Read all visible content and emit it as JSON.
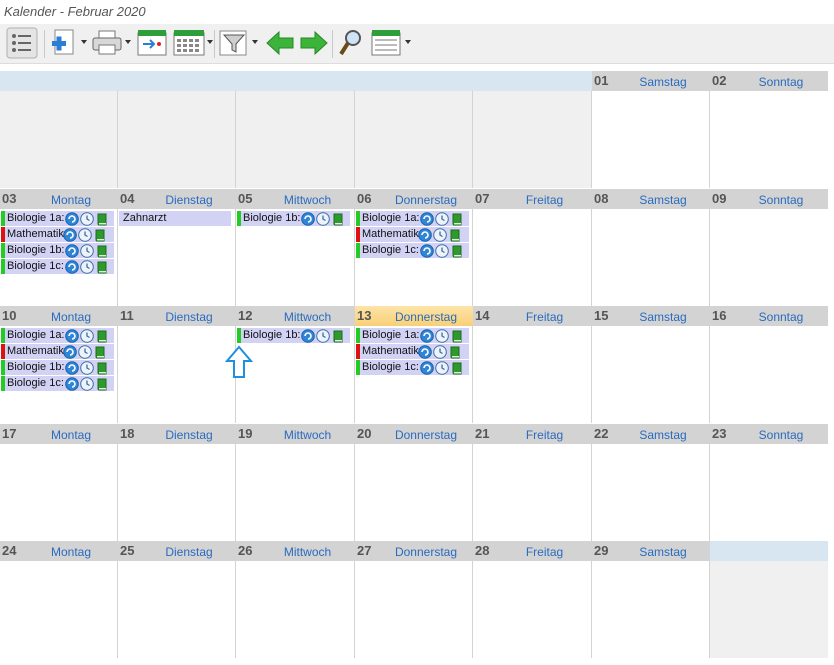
{
  "window": {
    "title": "Kalender - Februar 2020"
  },
  "toolbar": {
    "icons": [
      "list-icon",
      "add-document-icon",
      "print-icon",
      "goto-date-icon",
      "calendar-grid-icon",
      "filter-icon",
      "back-arrow-icon",
      "forward-arrow-icon",
      "search-icon",
      "calendar-view-icon"
    ]
  },
  "colors": {
    "header_gray": "#d3d3d3",
    "header_blue": "#d8e6f2",
    "today": "#f8cf77",
    "event_bg": "#d2d2f5",
    "green": "#22cc22",
    "red": "#dd1111",
    "dayname": "#2a6bbf"
  },
  "weeks": [
    {
      "days": [
        {
          "num": "",
          "name": ""
        },
        {
          "num": "",
          "name": ""
        },
        {
          "num": "",
          "name": ""
        },
        {
          "num": "",
          "name": ""
        },
        {
          "num": "",
          "name": ""
        },
        {
          "num": "01",
          "name": "Samstag"
        },
        {
          "num": "02",
          "name": "Sonntag"
        }
      ]
    },
    {
      "days": [
        {
          "num": "03",
          "name": "Montag"
        },
        {
          "num": "04",
          "name": "Dienstag"
        },
        {
          "num": "05",
          "name": "Mittwoch"
        },
        {
          "num": "06",
          "name": "Donnerstag"
        },
        {
          "num": "07",
          "name": "Freitag"
        },
        {
          "num": "08",
          "name": "Samstag"
        },
        {
          "num": "09",
          "name": "Sonntag"
        }
      ]
    },
    {
      "days": [
        {
          "num": "10",
          "name": "Montag"
        },
        {
          "num": "11",
          "name": "Dienstag"
        },
        {
          "num": "12",
          "name": "Mittwoch"
        },
        {
          "num": "13",
          "name": "Donnerstag",
          "today": true
        },
        {
          "num": "14",
          "name": "Freitag"
        },
        {
          "num": "15",
          "name": "Samstag"
        },
        {
          "num": "16",
          "name": "Sonntag"
        }
      ]
    },
    {
      "days": [
        {
          "num": "17",
          "name": "Montag"
        },
        {
          "num": "18",
          "name": "Dienstag"
        },
        {
          "num": "19",
          "name": "Mittwoch"
        },
        {
          "num": "20",
          "name": "Donnerstag"
        },
        {
          "num": "21",
          "name": "Freitag"
        },
        {
          "num": "22",
          "name": "Samstag"
        },
        {
          "num": "23",
          "name": "Sonntag"
        }
      ]
    },
    {
      "days": [
        {
          "num": "24",
          "name": "Montag"
        },
        {
          "num": "25",
          "name": "Dienstag"
        },
        {
          "num": "26",
          "name": "Mittwoch"
        },
        {
          "num": "27",
          "name": "Donnerstag"
        },
        {
          "num": "28",
          "name": "Freitag"
        },
        {
          "num": "29",
          "name": "Samstag"
        },
        {
          "num": "",
          "name": ""
        }
      ]
    }
  ],
  "events": [
    {
      "week": 1,
      "day": 0,
      "label": "Biologie 1a:",
      "bar": "green",
      "icons": true
    },
    {
      "week": 1,
      "day": 0,
      "label": "Mathematik",
      "bar": "red",
      "icons": true
    },
    {
      "week": 1,
      "day": 0,
      "label": "Biologie 1b:",
      "bar": "green",
      "icons": true
    },
    {
      "week": 1,
      "day": 0,
      "label": "Biologie 1c:",
      "bar": "green",
      "icons": true
    },
    {
      "week": 1,
      "day": 1,
      "label": "Zahnarzt",
      "bar": "none",
      "icons": false
    },
    {
      "week": 1,
      "day": 2,
      "label": "Biologie 1b:",
      "bar": "green",
      "icons": true
    },
    {
      "week": 1,
      "day": 3,
      "label": "Biologie 1a:",
      "bar": "green",
      "icons": true
    },
    {
      "week": 1,
      "day": 3,
      "label": "Mathematik",
      "bar": "red",
      "icons": true
    },
    {
      "week": 1,
      "day": 3,
      "label": "Biologie 1c:",
      "bar": "green",
      "icons": true
    },
    {
      "week": 2,
      "day": 0,
      "label": "Biologie 1a:",
      "bar": "green",
      "icons": true
    },
    {
      "week": 2,
      "day": 0,
      "label": "Mathematik",
      "bar": "red",
      "icons": true
    },
    {
      "week": 2,
      "day": 0,
      "label": "Biologie 1b:",
      "bar": "green",
      "icons": true
    },
    {
      "week": 2,
      "day": 0,
      "label": "Biologie 1c:",
      "bar": "green",
      "icons": true
    },
    {
      "week": 2,
      "day": 2,
      "label": "Biologie 1b:",
      "bar": "green",
      "icons": true
    },
    {
      "week": 2,
      "day": 3,
      "label": "Biologie 1a:",
      "bar": "green",
      "icons": true
    },
    {
      "week": 2,
      "day": 3,
      "label": "Mathematik",
      "bar": "red",
      "icons": true
    },
    {
      "week": 2,
      "day": 3,
      "label": "Biologie 1c:",
      "bar": "green",
      "icons": true
    }
  ]
}
